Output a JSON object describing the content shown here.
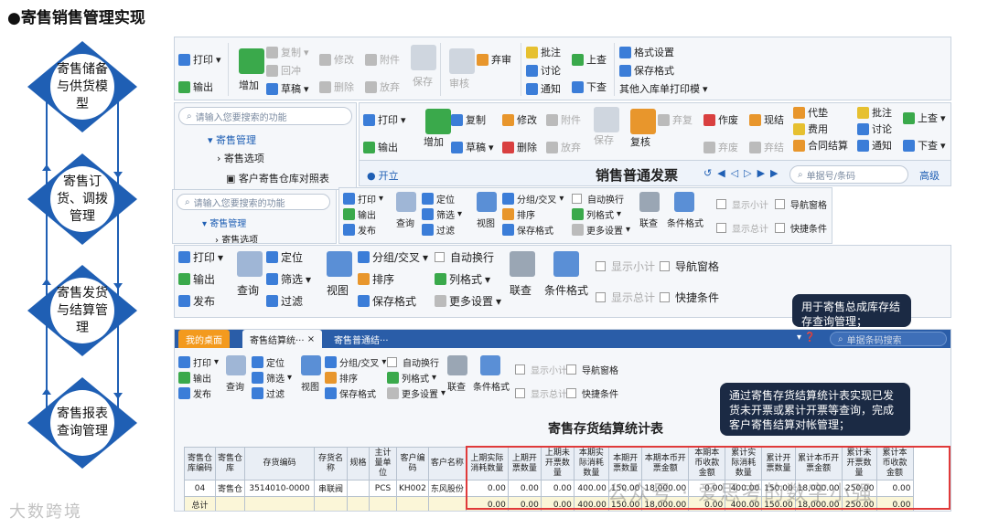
{
  "page_title": "●寄售销售管理实现",
  "flow": {
    "steps": [
      "寄售储备与供货模型",
      "寄售订货、调拨管理",
      "寄售发货与结算管理",
      "寄售报表查询管理"
    ],
    "color": "#1f5fb4"
  },
  "panel1": {
    "print": "打印",
    "export": "输出",
    "add": "增加",
    "copy": "复制",
    "reverse": "回冲",
    "draft": "草稿",
    "modify": "修改",
    "delete": "删除",
    "attach": "附件",
    "discard": "放弃",
    "save": "保存",
    "audit": "审核",
    "abandon": "弃审",
    "approve": "批注",
    "discuss": "讨论",
    "notify": "通知",
    "up": "上查",
    "down": "下查",
    "format": "格式设置",
    "save_format": "保存格式",
    "print_template": "其他入库单打印模",
    "search_placeholder": "请输入您要搜索的功能",
    "tree": [
      "寄售管理",
      "寄售选项",
      "客户寄售仓库对照表"
    ]
  },
  "panel2": {
    "print": "打印",
    "export": "输出",
    "add": "增加",
    "copy": "复制",
    "draft": "草稿",
    "modify": "修改",
    "delete": "删除",
    "attach": "附件",
    "discard": "放弃",
    "save": "保存",
    "review": "复核",
    "unreview": "弃复",
    "void": "作废",
    "unvoid": "弃废",
    "settle_now": "现结",
    "unsettle": "弃结",
    "advance": "代垫",
    "fee": "费用",
    "contract": "合同结算",
    "approve": "批注",
    "discuss": "讨论",
    "notify": "通知",
    "up": "上查",
    "down": "下查",
    "open": "开立",
    "title": "销售普通发票",
    "search_placeholder": "单据号/条码",
    "advanced": "高级"
  },
  "panel3": {
    "search_placeholder": "请输入您要搜索的功能",
    "tree": [
      "寄售管理",
      "寄售选项"
    ],
    "print": "打印",
    "export": "输出",
    "publish": "发布",
    "query": "查询",
    "locate": "定位",
    "filter": "筛选",
    "filter2": "过滤",
    "view": "视图",
    "group": "分组/交叉",
    "sort": "排序",
    "save_format": "保存格式",
    "auto_wrap": "自动换行",
    "col_format": "列格式",
    "more": "更多设置",
    "link": "联查",
    "cond_format": "条件格式",
    "subtotal": "显示小计",
    "total": "显示总计",
    "nav": "导航窗格",
    "quick": "快捷条件"
  },
  "panel4": {
    "print": "打印",
    "export": "输出",
    "publish": "发布",
    "query": "查询",
    "locate": "定位",
    "filter": "筛选",
    "filter2": "过滤",
    "view": "视图",
    "group": "分组/交叉",
    "sort": "排序",
    "save_format": "保存格式",
    "auto_wrap": "自动换行",
    "col_format": "列格式",
    "more": "更多设置",
    "link": "联查",
    "cond_format": "条件格式",
    "subtotal": "显示小计",
    "total": "显示总计",
    "nav": "导航窗格",
    "quick": "快捷条件"
  },
  "tooltip1": "用于寄售总成库存结存查询管理；",
  "report": {
    "tabs": [
      "我的桌面",
      "寄售结算统···",
      "寄售普通结···"
    ],
    "search_placeholder": "单据条码搜索",
    "print": "打印",
    "export": "输出",
    "publish": "发布",
    "query": "查询",
    "locate": "定位",
    "filter": "筛选",
    "filter2": "过滤",
    "view": "视图",
    "group": "分组/交叉",
    "sort": "排序",
    "save_format": "保存格式",
    "auto_wrap": "自动换行",
    "col_format": "列格式",
    "more": "更多设置",
    "link": "联查",
    "cond_format": "条件格式",
    "subtotal": "显示小计",
    "total": "显示总计",
    "nav": "导航窗格",
    "quick": "快捷条件",
    "title": "寄售存货结算统计表",
    "tooltip": "通过寄售存货结算统计表实现已发货未开票或累计开票等查询，完成客户寄售结算对帐管理；",
    "headers": [
      "寄售仓库编码",
      "寄售仓库",
      "存货编码",
      "存货名称",
      "规格",
      "主计量单位",
      "客户编码",
      "客户名称",
      "上期实际消耗数量",
      "上期开票数量",
      "上期未开票数量",
      "本期实际消耗数量",
      "本期开票数量",
      "本期本币开票金额",
      "本期本币收款金额",
      "累计实际消耗数量",
      "累计开票数量",
      "累计本币开票金额",
      "累计未开票数量",
      "累计本币收款金额"
    ],
    "rows": [
      [
        "04",
        "寄售仓",
        "3514010-0000",
        "串联阀",
        "",
        "PCS",
        "KH002",
        "东风股份",
        "0.00",
        "0.00",
        "0.00",
        "400.00",
        "150.00",
        "18,000.00",
        "0.00",
        "400.00",
        "150.00",
        "18,000.00",
        "250.00",
        "0.00"
      ],
      [
        "总计",
        "",
        "",
        "",
        "",
        "",
        "",
        "",
        "0.00",
        "0.00",
        "0.00",
        "400.00",
        "150.00",
        "18,000.00",
        "0.00",
        "400.00",
        "150.00",
        "18,000.00",
        "250.00",
        "0.00"
      ]
    ]
  },
  "watermark_left": "大数跨境",
  "watermark_right": "公众号 · 爱思考的数字小强"
}
